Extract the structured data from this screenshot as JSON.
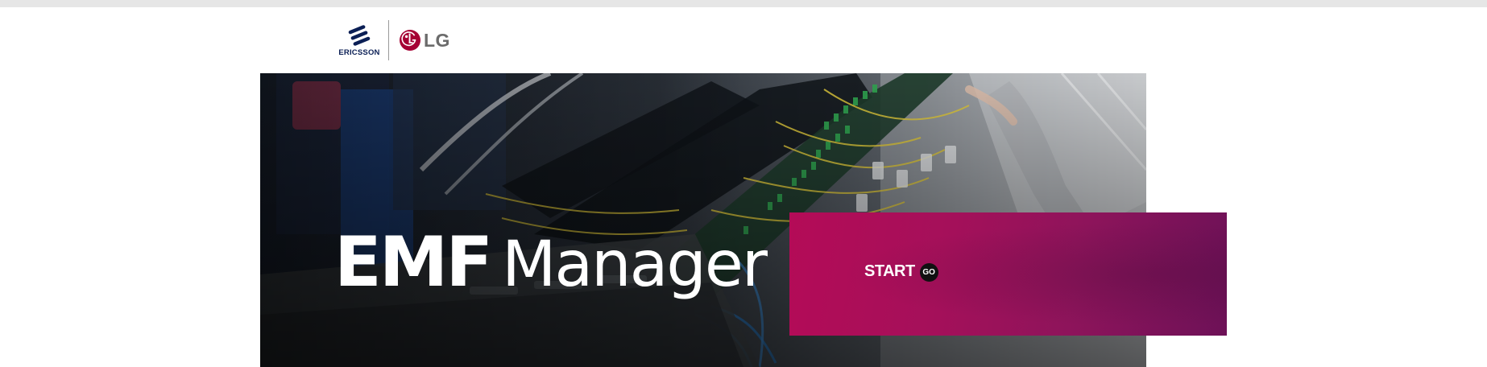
{
  "header": {
    "ericsson_logo": {
      "icon": "ericsson-logo-icon",
      "text": "ERICSSON",
      "color": "#0b1f55"
    },
    "lg_logo": {
      "icon": "lg-logo-icon",
      "text": "LG",
      "color": "#a50034"
    }
  },
  "hero": {
    "image": "network-cabling-photo",
    "title_bold": "EMF",
    "title_light": "Manager"
  },
  "cta": {
    "start_label": "START",
    "go_label": "GO",
    "panel_color": "#a5105a",
    "go_icon": "go-circle-icon"
  }
}
